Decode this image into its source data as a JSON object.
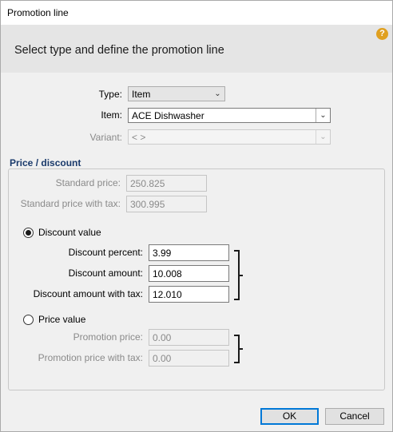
{
  "window": {
    "title": "Promotion line"
  },
  "header": {
    "heading": "Select type and define the promotion line",
    "help_icon": "?"
  },
  "form": {
    "type": {
      "label": "Type:",
      "value": "Item"
    },
    "item": {
      "label": "Item:",
      "value": "ACE Dishwasher"
    },
    "variant": {
      "label": "Variant:",
      "value": "< >"
    }
  },
  "price_discount": {
    "title": "Price / discount",
    "standard_price": {
      "label": "Standard price:",
      "value": "250.825"
    },
    "standard_price_tax": {
      "label": "Standard price with tax:",
      "value": "300.995"
    },
    "discount_value": {
      "label": "Discount value",
      "selected": true,
      "percent": {
        "label": "Discount percent:",
        "value": "3.99"
      },
      "amount": {
        "label": "Discount amount:",
        "value": "10.008"
      },
      "amount_tax": {
        "label": "Discount amount with tax:",
        "value": "12.010"
      }
    },
    "price_value": {
      "label": "Price value",
      "selected": false,
      "promo_price": {
        "label": "Promotion price:",
        "value": "0.00"
      },
      "promo_price_tax": {
        "label": "Promotion price with tax:",
        "value": "0.00"
      }
    }
  },
  "buttons": {
    "ok": "OK",
    "cancel": "Cancel"
  },
  "icons": {
    "dropdown": "chevron-down-icon",
    "help": "help-icon"
  },
  "colors": {
    "section_title": "#1a3a6b",
    "default_button_border": "#0078d7",
    "help_icon": "#e0a020"
  }
}
